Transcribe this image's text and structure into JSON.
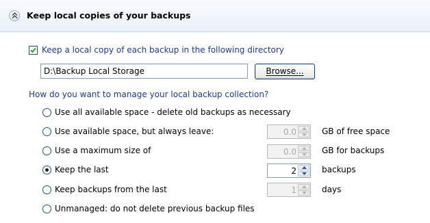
{
  "section": {
    "title": "Keep local copies of your backups",
    "collapse_icon": "collapse-up-icon"
  },
  "local_copy": {
    "checkbox_label": "Keep a local copy of each backup in the following directory",
    "checked": true,
    "directory_value": "D:\\Backup Local Storage",
    "browse_label": "Browse..."
  },
  "manage": {
    "question": "How do you want to manage your local backup collection?",
    "options": [
      {
        "label": "Use all available space - delete old backups as necessary",
        "selected": false
      },
      {
        "label": "Use available space, but always leave:",
        "selected": false,
        "value": "0.0",
        "unit": "GB of free space",
        "enabled": false
      },
      {
        "label": "Use a maximum size of",
        "selected": false,
        "value": "0.0",
        "unit": "GB for backups",
        "enabled": false
      },
      {
        "label": "Keep the last",
        "selected": true,
        "value": "2",
        "unit": "backups",
        "enabled": true
      },
      {
        "label": "Keep backups from the last",
        "selected": false,
        "value": "1",
        "unit": "days",
        "enabled": false
      },
      {
        "label": "Unmanaged: do not delete previous backup files",
        "selected": false
      }
    ]
  },
  "colors": {
    "link_blue": "#1a3a9a",
    "header_bg": "#eaf0f8"
  }
}
